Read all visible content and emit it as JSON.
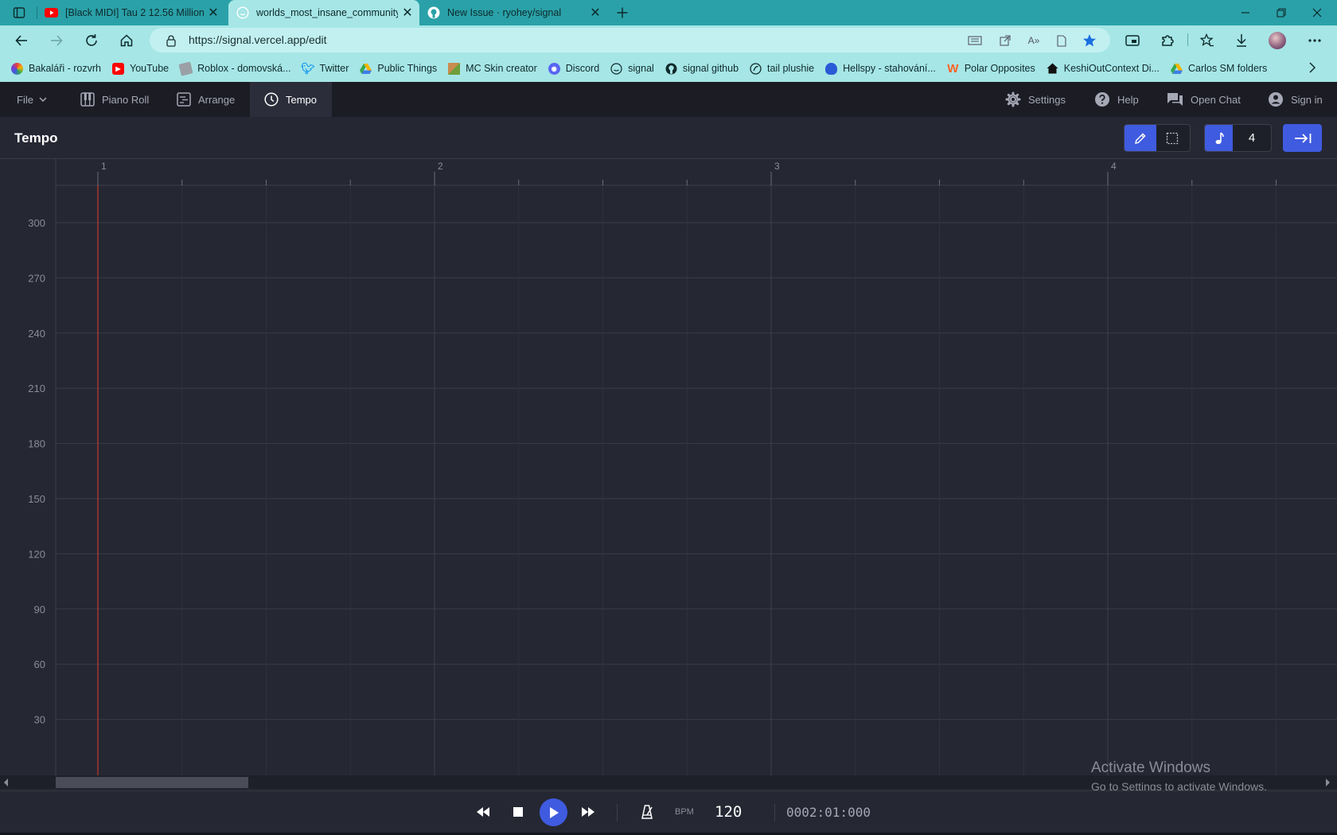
{
  "browser": {
    "tabs": [
      {
        "title": "[Black MIDI] Tau 2 12.56 Million |",
        "icon": "youtube-icon",
        "active": false
      },
      {
        "title": "worlds_most_insane_community",
        "icon": "signal-icon",
        "active": true
      },
      {
        "title": "New Issue · ryohey/signal",
        "icon": "github-icon",
        "active": false
      }
    ],
    "url": "https://signal.vercel.app/edit",
    "bookmarks": [
      {
        "label": "Bakaláři - rozvrh",
        "icon": "bakalari-icon",
        "color": "#7b3fd0"
      },
      {
        "label": "YouTube",
        "icon": "youtube-icon",
        "color": "#ff0000"
      },
      {
        "label": "Roblox - domovská...",
        "icon": "roblox-icon",
        "color": "#8a8a8a"
      },
      {
        "label": "Twitter",
        "icon": "twitter-icon",
        "color": "#1d9bf0"
      },
      {
        "label": "Public Things",
        "icon": "google-drive-icon",
        "color": "#34a853"
      },
      {
        "label": "MC Skin creator",
        "icon": "minecraft-icon",
        "color": "#b5651d"
      },
      {
        "label": "Discord",
        "icon": "discord-icon",
        "color": "#5865f2"
      },
      {
        "label": "signal",
        "icon": "signal-icon",
        "color": "#3f5be0"
      },
      {
        "label": "signal github",
        "icon": "github-icon",
        "color": "#24292e"
      },
      {
        "label": "tail plushie",
        "icon": "tail-icon",
        "color": "#333333"
      },
      {
        "label": "Hellspy - stahování...",
        "icon": "hellspy-icon",
        "color": "#2a5bd7"
      },
      {
        "label": "Polar Opposites",
        "icon": "wattpad-icon",
        "color": "#ff6122"
      },
      {
        "label": "KeshiOutContext Di...",
        "icon": "home-icon",
        "color": "#111111"
      },
      {
        "label": "Carlos SM folders",
        "icon": "google-drive-icon",
        "color": "#34a853"
      }
    ]
  },
  "app": {
    "nav": {
      "file": "File",
      "piano_roll": "Piano Roll",
      "arrange": "Arrange",
      "tempo": "Tempo",
      "settings": "Settings",
      "help": "Help",
      "open_chat": "Open Chat",
      "sign_in": "Sign in"
    },
    "toolbar": {
      "title": "Tempo",
      "quantize": "4",
      "active_tool": "pencil"
    },
    "accent_color": "#3f5be0",
    "playhead_color": "#c0392b",
    "tempo_graph": {
      "bpm_ticks": [
        "300",
        "270",
        "240",
        "210",
        "180",
        "150",
        "120",
        "90",
        "60",
        "30"
      ],
      "measures": [
        "1",
        "2",
        "3",
        "4"
      ],
      "playhead_measure": 1,
      "scrollbar_fraction": 0.15
    },
    "transport": {
      "bpm_label": "BPM",
      "bpm_value": "120",
      "time": "0002:01:000"
    }
  },
  "os": {
    "watermark_line1": "Activate Windows",
    "watermark_line2": "Go to Settings to activate Windows."
  }
}
